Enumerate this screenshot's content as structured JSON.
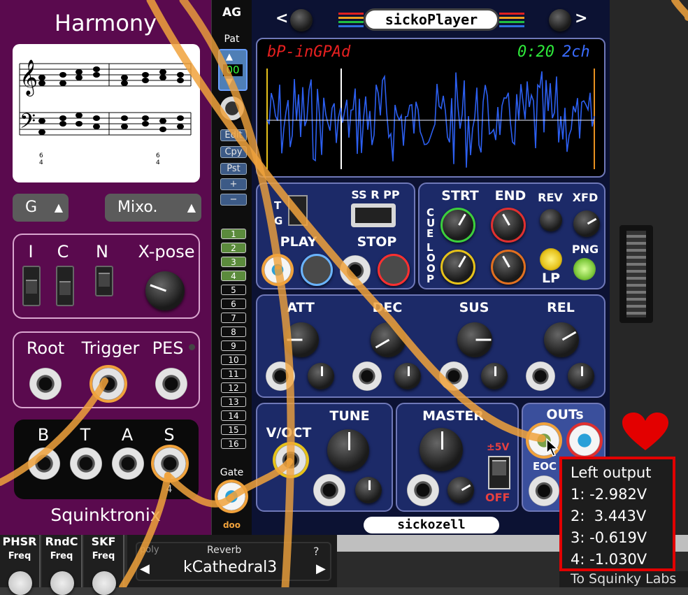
{
  "harmony": {
    "title": "Harmony",
    "key_select": "G",
    "mode_select": "Mixo.",
    "switch_labels": [
      "I",
      "C",
      "N"
    ],
    "xpose_label": "X-pose",
    "io_labels": [
      "Root",
      "Trigger",
      "PES"
    ],
    "voice_labels": [
      "B",
      "T",
      "A",
      "S"
    ],
    "voice_count": "4",
    "brand": "Squinktronix",
    "score_figures": [
      "6",
      "4",
      "6",
      "4"
    ]
  },
  "ag": {
    "title": "AG",
    "pat_label": "Pat",
    "pat_value": "00",
    "buttons": [
      "Edit",
      "Cpy",
      "Pst",
      "+",
      "−"
    ],
    "steps": [
      "1",
      "2",
      "3",
      "4",
      "5",
      "6",
      "7",
      "8",
      "9",
      "10",
      "11",
      "12",
      "13",
      "14",
      "15",
      "16"
    ],
    "gate_label": "Gate",
    "logo": "doo"
  },
  "sicko": {
    "title": "sickoPlayer",
    "nav_prev": "<",
    "nav_next": ">",
    "file_name": "bP-inGPAd",
    "time": "0:20",
    "channels": "2ch",
    "tg_label": "T\nG",
    "mode_label": "SS R PP",
    "play_label": "PLAY",
    "stop_label": "STOP",
    "cue_label": "CUE",
    "loop_label": "LOOP",
    "strt_label": "STRT",
    "end_label": "END",
    "rev_label": "REV",
    "xfd_label": "XFD",
    "lp_label": "LP",
    "png_label": "PNG",
    "env_labels": [
      "ATT",
      "DEC",
      "SUS",
      "REL"
    ],
    "voct_label": "V/OCT",
    "tune_label": "TUNE",
    "master_label": "MASTER",
    "range_label": "±5V",
    "off_label": "OFF",
    "outs_label": "OUTs",
    "eoc_label": "EOC",
    "brand": "sickozell"
  },
  "tooltip": {
    "title": "Left output",
    "lines": [
      "1: -2.982V",
      "2:  3.443V",
      "3: -0.619V",
      "4: -1.030V"
    ],
    "footer": "To Squinky Labs"
  },
  "bottom": {
    "modules": [
      {
        "name": "PHSR",
        "param": "Freq"
      },
      {
        "name": "RndC",
        "param": "Freq"
      },
      {
        "name": "SKF",
        "param": "Freq"
      }
    ],
    "reverb_poly": "poly",
    "reverb_title": "Reverb",
    "reverb_help": "?",
    "reverb_preset": "kCathedral3",
    "arrow_left": "◀",
    "arrow_right": "▶"
  },
  "colors": {
    "harmony_bg": "#5a0a4e",
    "sicko_bg": "#0c1233",
    "wire": "#f0a23c",
    "tooltip_border": "#e20000",
    "heart": "#e30000"
  }
}
